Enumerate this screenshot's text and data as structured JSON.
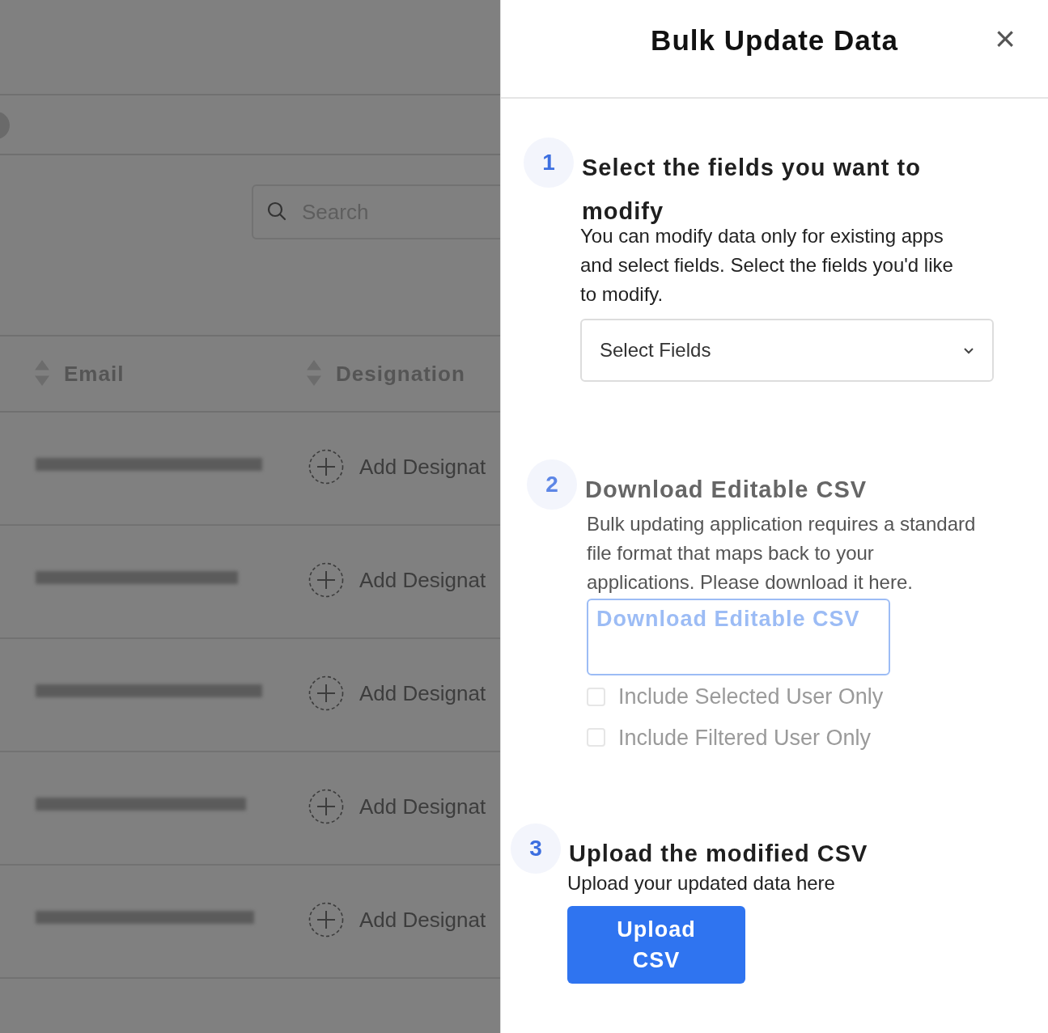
{
  "background": {
    "search": {
      "placeholder": "Search"
    },
    "columns": [
      "Email",
      "Designation"
    ],
    "rows": [
      {
        "action": "Add Designat"
      },
      {
        "action": "Add Designat"
      },
      {
        "action": "Add Designat"
      },
      {
        "action": "Add Designat"
      },
      {
        "action": "Add Designat"
      }
    ]
  },
  "panel": {
    "title": "Bulk Update Data",
    "close": "×",
    "steps": [
      {
        "number": "1",
        "title": "Select the fields you want to modify",
        "description": "You can modify data only for existing apps and select fields. Select the fields you'd like to modify.",
        "disabled": false,
        "kind": "select",
        "select": {
          "placeholder": "Select Fields"
        }
      },
      {
        "number": "2",
        "title": "Download Editable CSV",
        "description": "Bulk updating application requires a standard file format that maps back to your applications. Please download it here.",
        "disabled": true,
        "kind": "download",
        "button": "Download Editable CSV",
        "options": [
          {
            "label": "Include Selected User Only",
            "checked": false
          },
          {
            "label": "Include Filtered User Only",
            "checked": false
          }
        ]
      },
      {
        "number": "3",
        "title": "Upload the modified CSV",
        "description": "Upload your updated data here",
        "disabled": false,
        "kind": "upload",
        "button": "Upload CSV"
      }
    ]
  }
}
